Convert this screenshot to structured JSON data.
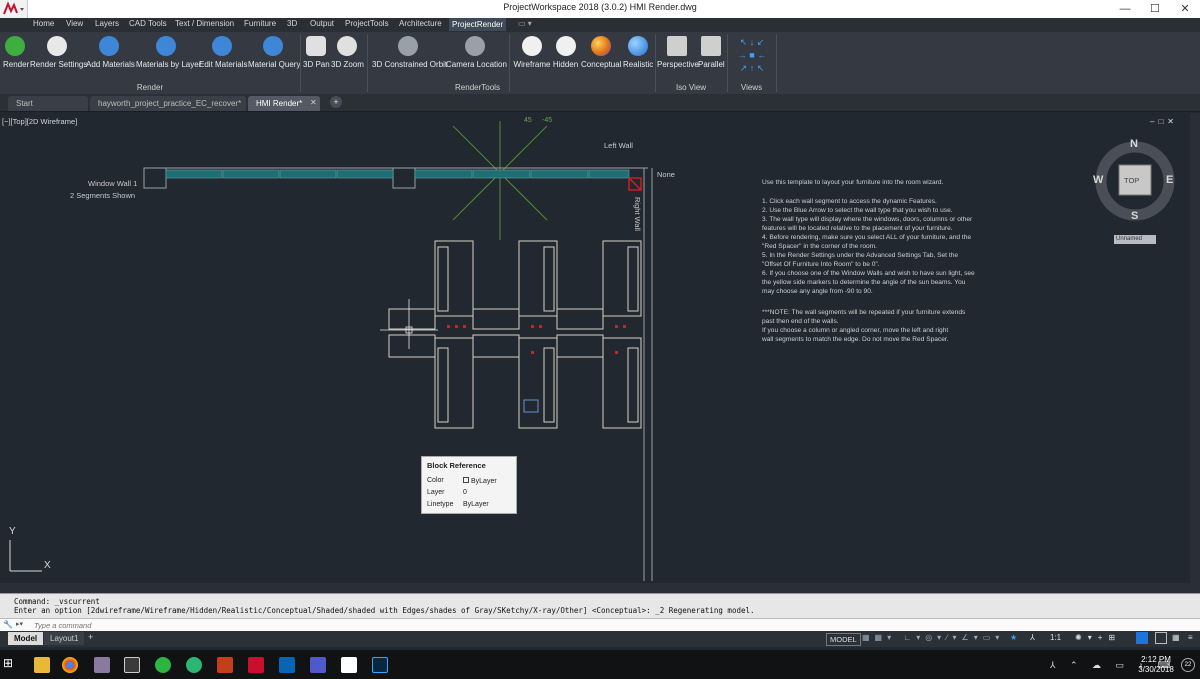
{
  "window": {
    "title": "ProjectWorkspace 2018 (3.0.2)    HMI Render.dwg",
    "controls": [
      "—",
      "☐",
      "✕"
    ]
  },
  "menu": {
    "items": [
      "Home",
      "View",
      "Layers",
      "CAD Tools",
      "Text / Dimension",
      "Furniture",
      "3D",
      "Output",
      "ProjectTools",
      "Architecture",
      "ProjectRender"
    ],
    "active": "ProjectRender"
  },
  "ribbon": {
    "buttons": [
      "Render",
      "Render Settings",
      "Add Materials",
      "Materials by Layer",
      "Edit Materials",
      "Material Query",
      "3D Pan",
      "3D Zoom",
      "3D Constrained Orbit",
      "Camera Location",
      "Wireframe",
      "Hidden",
      "Conceptual",
      "Realistic",
      "Perspective",
      "Parallel"
    ],
    "groups": [
      "Render",
      "RenderTools",
      "Iso View",
      "Views"
    ]
  },
  "doc_tabs": [
    "Start",
    "hayworth_project_practice_EC_recover*",
    "HMI Render*"
  ],
  "viewport": {
    "label": "[−][Top][2D Wireframe]",
    "compass": {
      "n": "N",
      "s": "S",
      "e": "E",
      "w": "W",
      "top": "TOP",
      "ucs": "Unnamed"
    },
    "angles": [
      "45",
      "-45"
    ],
    "wall_labels": {
      "left_wall": "Left Wall",
      "window_wall": "Window Wall 1",
      "segments": "2 Segments Shown",
      "none": "None",
      "right_wall": "Right Wall"
    },
    "tooltip": {
      "title": "Block Reference",
      "rows": [
        {
          "label": "Color",
          "value": "ByLayer"
        },
        {
          "label": "Layer",
          "value": "0"
        },
        {
          "label": "Linetype",
          "value": "ByLayer"
        }
      ]
    },
    "instructions": [
      "Use this template to layout your furniture into the room wizard.",
      "1.     Click each wall segment to access the dynamic Features.",
      "2.     Use the Blue Arrow to select the wall type that you wish to use.",
      "3.     The wall type will display where the windows, doors, columns or other",
      "         features will be located relative to the placement of your furniture.",
      "4.     Before rendering, make sure you select ALL of your furniture, and the",
      "         \"Red Spacer\" in the corner of the room.",
      "5.     In the Render Settings under the Advanced Settings Tab, Set the",
      "         \"Offset Of Furniture Into Room\" to be 0\".",
      "6.     If you choose one of the Window Walls and wish to have sun light, see",
      "         the yellow side markers to determine the angle of the sun beams.  You",
      "         may choose any angle from -90 to 90.",
      "",
      "***NOTE:     The wall segments will be repeated if your furniture extends",
      "         past then end of the walls.",
      "                  If you choose a column or angled corner, move the left and right",
      "         wall segments to match the edge.  Do not move the Red Spacer."
    ]
  },
  "command": {
    "line1": "Command: _vscurrent",
    "line2": "Enter an option [2dwireframe/Wireframe/Hidden/Realistic/Conceptual/Shaded/shaded with Edges/shades of Gray/SKetchy/X-ray/Other] <Conceptual>: _2 Regenerating model.",
    "placeholder": "Type a command"
  },
  "status": {
    "layout_tabs": [
      "Model",
      "Layout1"
    ],
    "model_label": "MODEL",
    "scale": "1:1"
  },
  "taskbar": {
    "time": "2:12 PM",
    "date": "3/30/2018",
    "badge": "22"
  },
  "colors": {
    "accent": "#3f4a58",
    "canvas": "#212830",
    "window_segment": "#1f6e73",
    "spacer": "#d21f26"
  }
}
